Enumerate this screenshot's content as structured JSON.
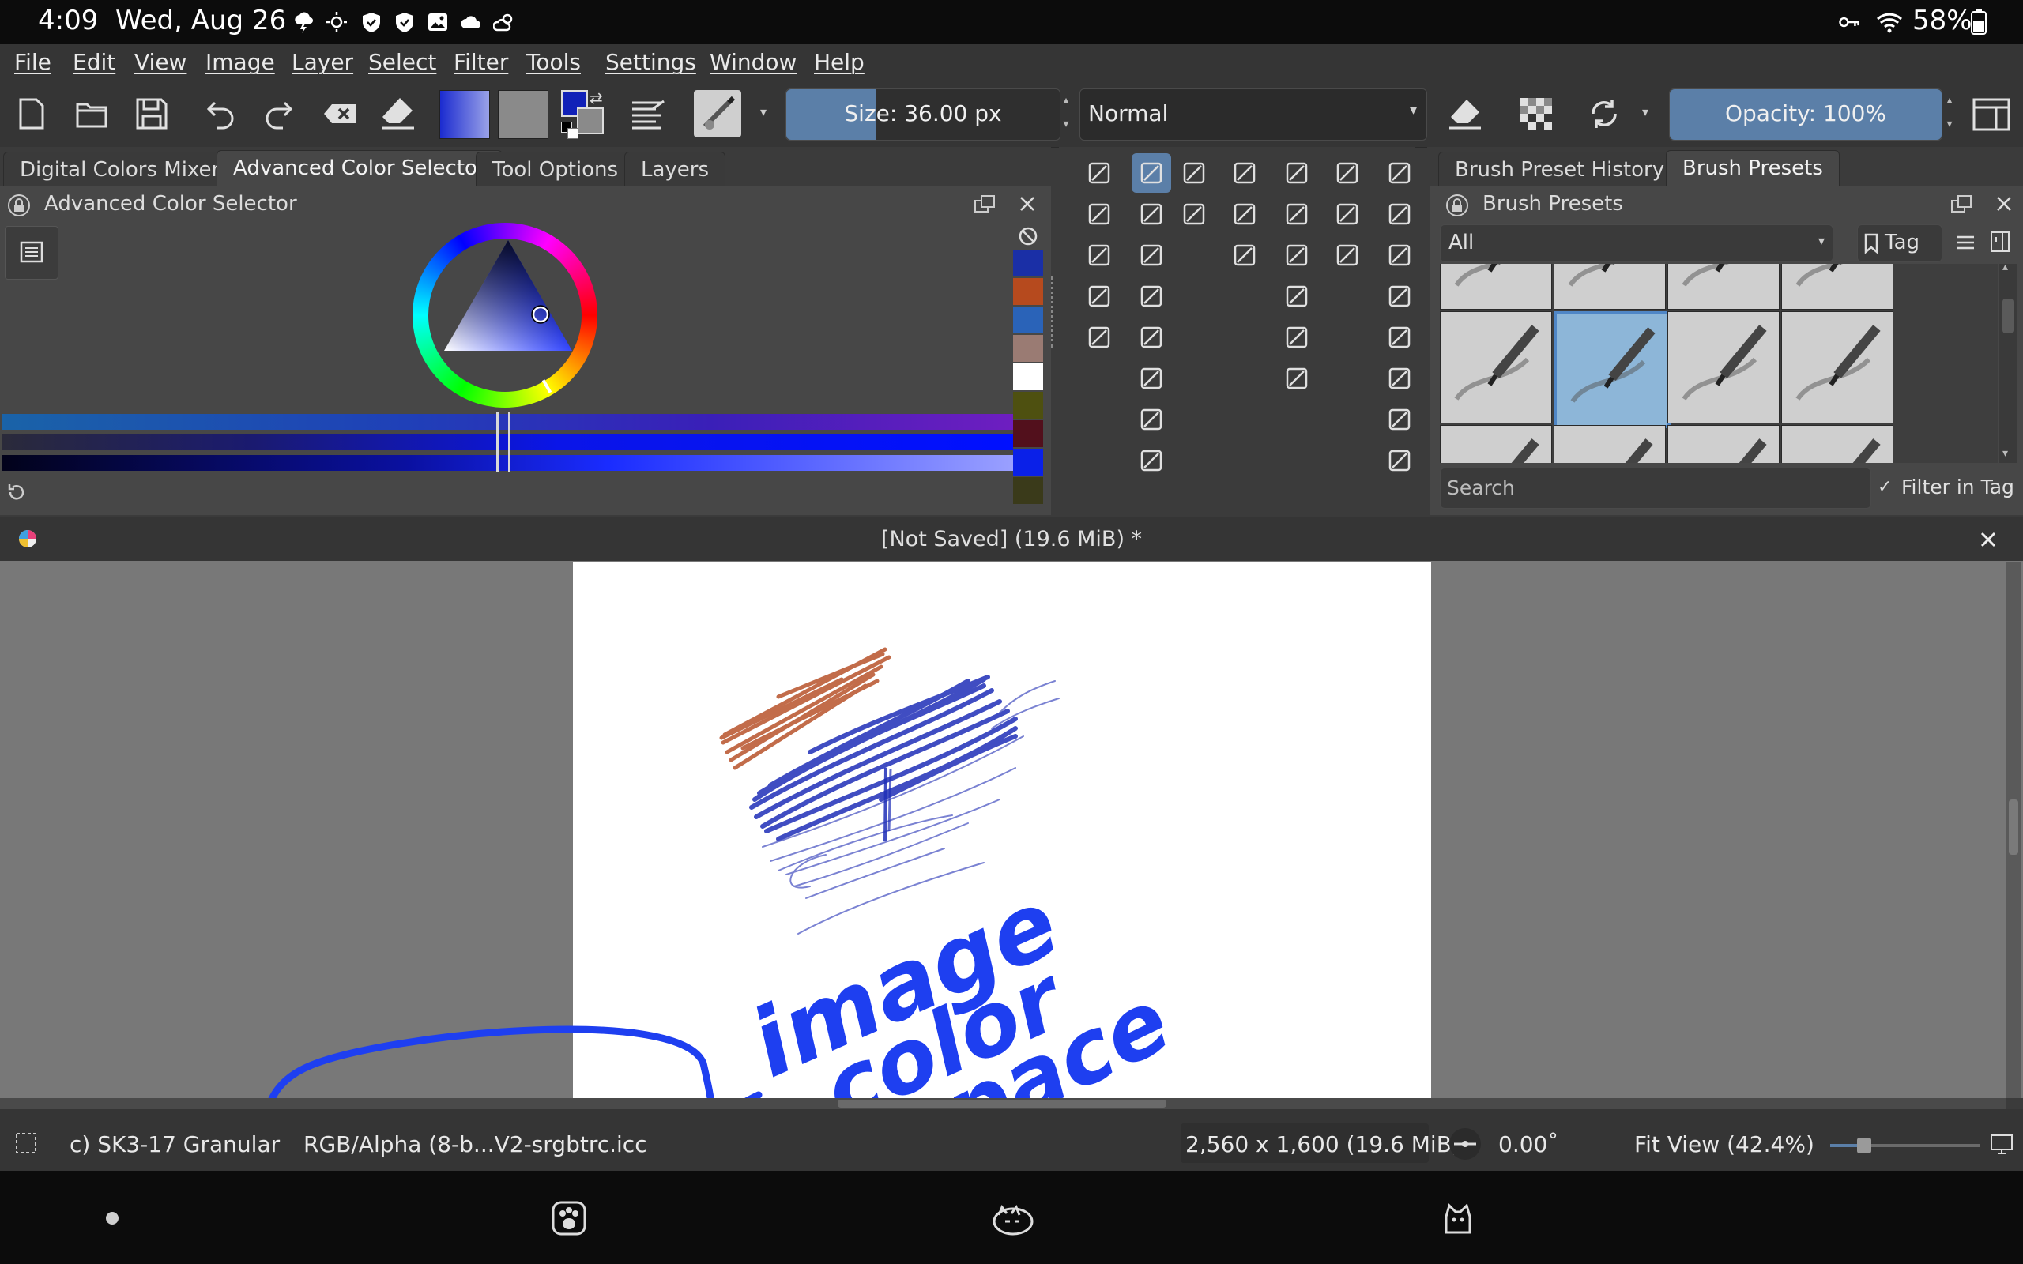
{
  "status_bar": {
    "time": "4:09",
    "date": "Wed, Aug 26",
    "battery": "58%",
    "left_icons": [
      "weather-storm-icon",
      "sun-icon",
      "shield-icon",
      "shield-icon",
      "image-icon",
      "cloud-icon",
      "partly-cloudy-icon"
    ],
    "right_icons": [
      "key-icon",
      "wifi-icon",
      "battery-icon"
    ]
  },
  "menu": [
    "File",
    "Edit",
    "View",
    "Image",
    "Layer",
    "Select",
    "Filter",
    "Tools",
    "Settings",
    "Window",
    "Help"
  ],
  "toolbar": {
    "size_label": "Size: 36.00 px",
    "size_fraction": 0.33,
    "blend_mode": "Normal",
    "opacity_label": "Opacity: 100%",
    "opacity_fraction": 1.0
  },
  "left_dock": {
    "tabs": [
      "Digital Colors Mixer",
      "Advanced Color Selector",
      "Tool Options",
      "Layers"
    ],
    "active_tab": "Advanced Color Selector",
    "title": "Advanced Color Selector",
    "swatch_colors": [
      "#1a2fa6",
      "#b64a1e",
      "#2a63b8",
      "#9a7b73",
      "#ffffff",
      "#4e5010",
      "#52101c",
      "#0a20e8",
      "#3a3a1a"
    ]
  },
  "right_dock": {
    "tabs": [
      "Brush Preset History",
      "Brush Presets"
    ],
    "active_tab": "Brush Presets",
    "title": "Brush Presets",
    "tag_filter": "All",
    "tag_button": "Tag",
    "search_placeholder": "Search",
    "filter_in_tag": "Filter in Tag",
    "filter_checked": true
  },
  "document": {
    "title": "[Not Saved]  (19.6 MiB) *"
  },
  "annotation": {
    "line1": "image",
    "line2": "color",
    "line3": "space"
  },
  "bottom_bar": {
    "brush_name": "c) SK3-17 Granular",
    "color_space": "RGB/Alpha (8-b...V2-srgbtrc.icc",
    "dimensions": "2,560 x 1,600 (19.6 MiB)",
    "rotation": "0.00˚",
    "zoom": "Fit View (42.4%)"
  },
  "colors": {
    "accent": "#5b7fa8",
    "brush_blue": "#1f2fb8",
    "brush_orange": "#b8532b",
    "annotation_blue": "#1e3ff0"
  }
}
